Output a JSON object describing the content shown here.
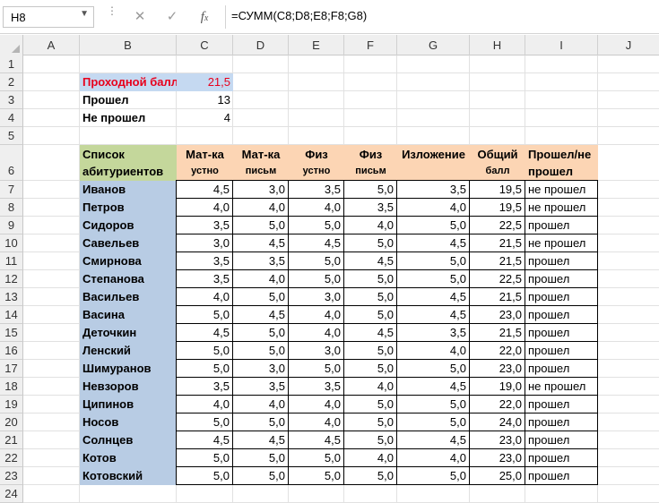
{
  "name_box": "H8",
  "formula": "=СУММ(C8;D8;E8;F8;G8)",
  "columns": [
    "A",
    "B",
    "C",
    "D",
    "E",
    "F",
    "G",
    "H",
    "I",
    "J"
  ],
  "rows": [
    "1",
    "2",
    "3",
    "4",
    "5",
    "6",
    "7",
    "8",
    "9",
    "10",
    "11",
    "12",
    "13",
    "14",
    "15",
    "16",
    "17",
    "18",
    "19",
    "20",
    "21",
    "22",
    "23",
    "24"
  ],
  "summary": [
    {
      "label": "Проходной балл",
      "value": "21,5"
    },
    {
      "label": "Прошел",
      "value": "13"
    },
    {
      "label": "Не прошел",
      "value": "4"
    }
  ],
  "headers": {
    "list_line1": "Список",
    "list_line2": "абитуриентов",
    "mat_ust_1": "Мат-ка",
    "mat_ust_2": "устно",
    "mat_pis_1": "Мат-ка",
    "mat_pis_2": "письм",
    "fiz_ust_1": "Физ",
    "fiz_ust_2": "устно",
    "fiz_pis_1": "Физ",
    "fiz_pis_2": "письм",
    "izl": "Изложение",
    "total_1": "Общий",
    "total_2": "балл",
    "res_1": "Прошел/не",
    "res_2": "прошел"
  },
  "students": [
    {
      "name": "Иванов",
      "c": "4,5",
      "d": "3,0",
      "e": "3,5",
      "f": "5,0",
      "g": "3,5",
      "h": "19,5",
      "i": "не прошел"
    },
    {
      "name": "Петров",
      "c": "4,0",
      "d": "4,0",
      "e": "4,0",
      "f": "3,5",
      "g": "4,0",
      "h": "19,5",
      "i": "не прошел"
    },
    {
      "name": "Сидоров",
      "c": "3,5",
      "d": "5,0",
      "e": "5,0",
      "f": "4,0",
      "g": "5,0",
      "h": "22,5",
      "i": "прошел"
    },
    {
      "name": "Савельев",
      "c": "3,0",
      "d": "4,5",
      "e": "4,5",
      "f": "5,0",
      "g": "4,5",
      "h": "21,5",
      "i": "не прошел"
    },
    {
      "name": "Смирнова",
      "c": "3,5",
      "d": "3,5",
      "e": "5,0",
      "f": "4,5",
      "g": "5,0",
      "h": "21,5",
      "i": "прошел"
    },
    {
      "name": "Степанова",
      "c": "3,5",
      "d": "4,0",
      "e": "5,0",
      "f": "5,0",
      "g": "5,0",
      "h": "22,5",
      "i": "прошел"
    },
    {
      "name": "Васильев",
      "c": "4,0",
      "d": "5,0",
      "e": "3,0",
      "f": "5,0",
      "g": "4,5",
      "h": "21,5",
      "i": "прошел"
    },
    {
      "name": "Васина",
      "c": "5,0",
      "d": "4,5",
      "e": "4,0",
      "f": "5,0",
      "g": "4,5",
      "h": "23,0",
      "i": "прошел"
    },
    {
      "name": "Деточкин",
      "c": "4,5",
      "d": "5,0",
      "e": "4,0",
      "f": "4,5",
      "g": "3,5",
      "h": "21,5",
      "i": "прошел"
    },
    {
      "name": "Ленский",
      "c": "5,0",
      "d": "5,0",
      "e": "3,0",
      "f": "5,0",
      "g": "4,0",
      "h": "22,0",
      "i": "прошел"
    },
    {
      "name": "Шимуранов",
      "c": "5,0",
      "d": "3,0",
      "e": "5,0",
      "f": "5,0",
      "g": "5,0",
      "h": "23,0",
      "i": "прошел"
    },
    {
      "name": "Невзоров",
      "c": "3,5",
      "d": "3,5",
      "e": "3,5",
      "f": "4,0",
      "g": "4,5",
      "h": "19,0",
      "i": "не прошел"
    },
    {
      "name": "Ципинов",
      "c": "4,0",
      "d": "4,0",
      "e": "4,0",
      "f": "5,0",
      "g": "5,0",
      "h": "22,0",
      "i": "прошел"
    },
    {
      "name": "Носов",
      "c": "5,0",
      "d": "5,0",
      "e": "4,0",
      "f": "5,0",
      "g": "5,0",
      "h": "24,0",
      "i": "прошел"
    },
    {
      "name": "Солнцев",
      "c": "4,5",
      "d": "4,5",
      "e": "4,5",
      "f": "5,0",
      "g": "4,5",
      "h": "23,0",
      "i": "прошел"
    },
    {
      "name": "Котов",
      "c": "5,0",
      "d": "5,0",
      "e": "5,0",
      "f": "4,0",
      "g": "4,0",
      "h": "23,0",
      "i": "прошел"
    },
    {
      "name": "Котовский",
      "c": "5,0",
      "d": "5,0",
      "e": "5,0",
      "f": "5,0",
      "g": "5,0",
      "h": "25,0",
      "i": "прошел"
    }
  ],
  "colors": {
    "header_orange": "#fcd5b4",
    "list_green": "#c4d79b",
    "name_blue": "#b8cce4",
    "red_text": "#e8001c",
    "passing_bg": "#c5d9f1"
  }
}
